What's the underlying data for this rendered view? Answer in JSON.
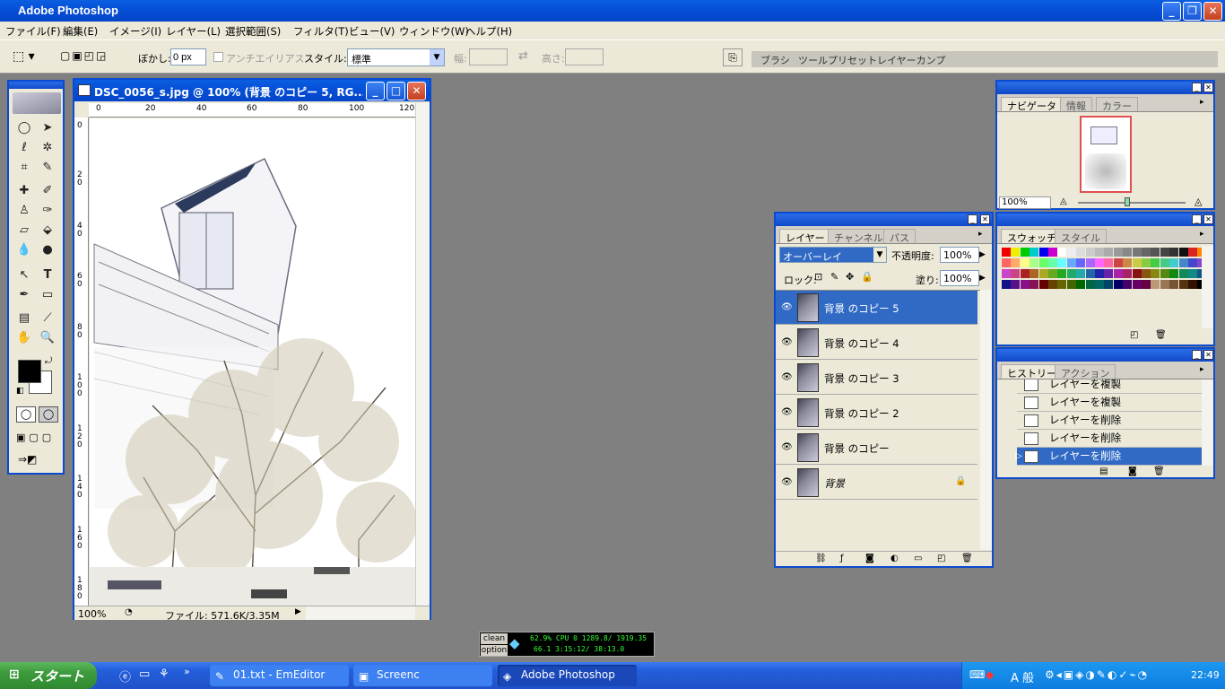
{
  "app": {
    "title": "Adobe Photoshop"
  },
  "menu": [
    "ファイル(F)",
    "編集(E)",
    "イメージ(I)",
    "レイヤー(L)",
    "選択範囲(S)",
    "フィルタ(T)",
    "ビュー(V)",
    "ウィンドウ(W)",
    "ヘルプ(H)"
  ],
  "options": {
    "feather_label": "ぼかし:",
    "feather_value": "0 px",
    "antialias_label": "アンチエイリアス",
    "style_label": "スタイル:",
    "style_value": "標準",
    "width_label": "幅:",
    "height_label": "高さ:",
    "well_tabs": [
      "ブラシ",
      "ツールプリセット",
      "レイヤーカンプ"
    ]
  },
  "document": {
    "title": "DSC_0056_s.jpg @ 100% (背景 のコピー 5, RG...",
    "zoom": "100%",
    "file_info": "ファイル: 571.6K/3.35M",
    "ruler_h": [
      "0",
      "20",
      "40",
      "60",
      "80",
      "100",
      "120"
    ],
    "ruler_v": [
      "0",
      "20",
      "40",
      "60",
      "80",
      "100",
      "120",
      "140",
      "160",
      "180"
    ]
  },
  "navigator": {
    "tabs": [
      "ナビゲータ",
      "情報",
      "カラー"
    ],
    "zoom": "100%"
  },
  "swatches": {
    "tabs": [
      "スウォッチ",
      "スタイル"
    ]
  },
  "history": {
    "tabs": [
      "ヒストリー",
      "アクション"
    ],
    "items": [
      "レイヤーを複製",
      "レイヤーを複製",
      "レイヤーを削除",
      "レイヤーを削除",
      "レイヤーを削除"
    ],
    "selected_index": 4
  },
  "layers": {
    "tabs": [
      "レイヤー",
      "チャンネル",
      "パス"
    ],
    "blend_mode": "オーバーレイ",
    "opacity_label": "不透明度:",
    "opacity": "100%",
    "lock_label": "ロック:",
    "fill_label": "塗り:",
    "fill": "100%",
    "items": [
      "背景 のコピー 5",
      "背景 のコピー 4",
      "背景 のコピー 3",
      "背景 のコピー 2",
      "背景 のコピー",
      "背景"
    ],
    "selected_index": 0
  },
  "monitor": {
    "btn_clean": "clean",
    "btn_option": "option",
    "line1": "62.9% CPU 0 1289.8/ 1919.35",
    "line2": "66.1 3:15:12/ 38:13.0"
  },
  "taskbar": {
    "start": "スタート",
    "tasks": [
      "01.txt - EmEditor",
      "Screenc",
      "Adobe Photoshop"
    ],
    "ime": "A 般",
    "clock": "22:49"
  },
  "colors": {
    "titlebar": "#0a5fe0",
    "selection": "#316ac5",
    "taskbar": "#245edb",
    "start": "#3c9a3c"
  }
}
